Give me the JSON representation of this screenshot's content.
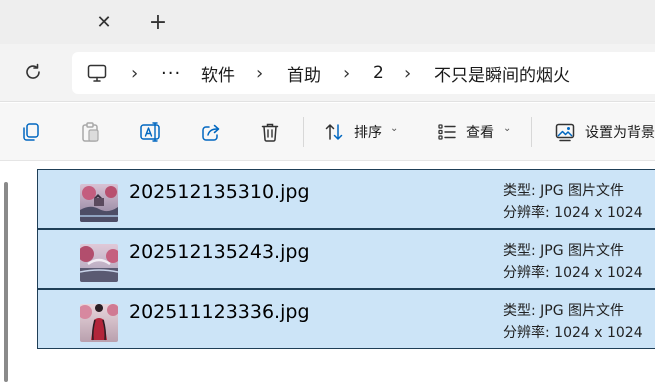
{
  "tab": {
    "close_icon": "close-icon",
    "new_tab_icon": "plus-icon",
    "close_glyph": "✕",
    "new_glyph": "+"
  },
  "navigation": {
    "refresh_icon": "refresh-icon",
    "breadcrumb": {
      "computer_icon": "computer-icon",
      "overflow": "···",
      "items": [
        "软件",
        "首助",
        "2",
        "不只是瞬间的烟火"
      ],
      "separator": "›"
    }
  },
  "toolbar": {
    "icons": [
      "copy-icon",
      "paste-icon",
      "rename-icon",
      "share-icon",
      "delete-icon"
    ],
    "sort_label": "排序",
    "view_label": "查看",
    "set_background_label": "设置为背景"
  },
  "files": [
    {
      "name": "202512135310.jpg",
      "type": "类型: JPG 图片文件",
      "resolution": "分辨率: 1024 x 1024"
    },
    {
      "name": "202512135243.jpg",
      "type": "类型: JPG 图片文件",
      "resolution": "分辨率: 1024 x 1024"
    },
    {
      "name": "202511123336.jpg",
      "type": "类型: JPG 图片文件",
      "resolution": "分辨率: 1024 x 1024"
    }
  ],
  "colors": {
    "selection": "#cce4f7",
    "selection_border": "#1f3f57",
    "accent": "#0067c0"
  }
}
